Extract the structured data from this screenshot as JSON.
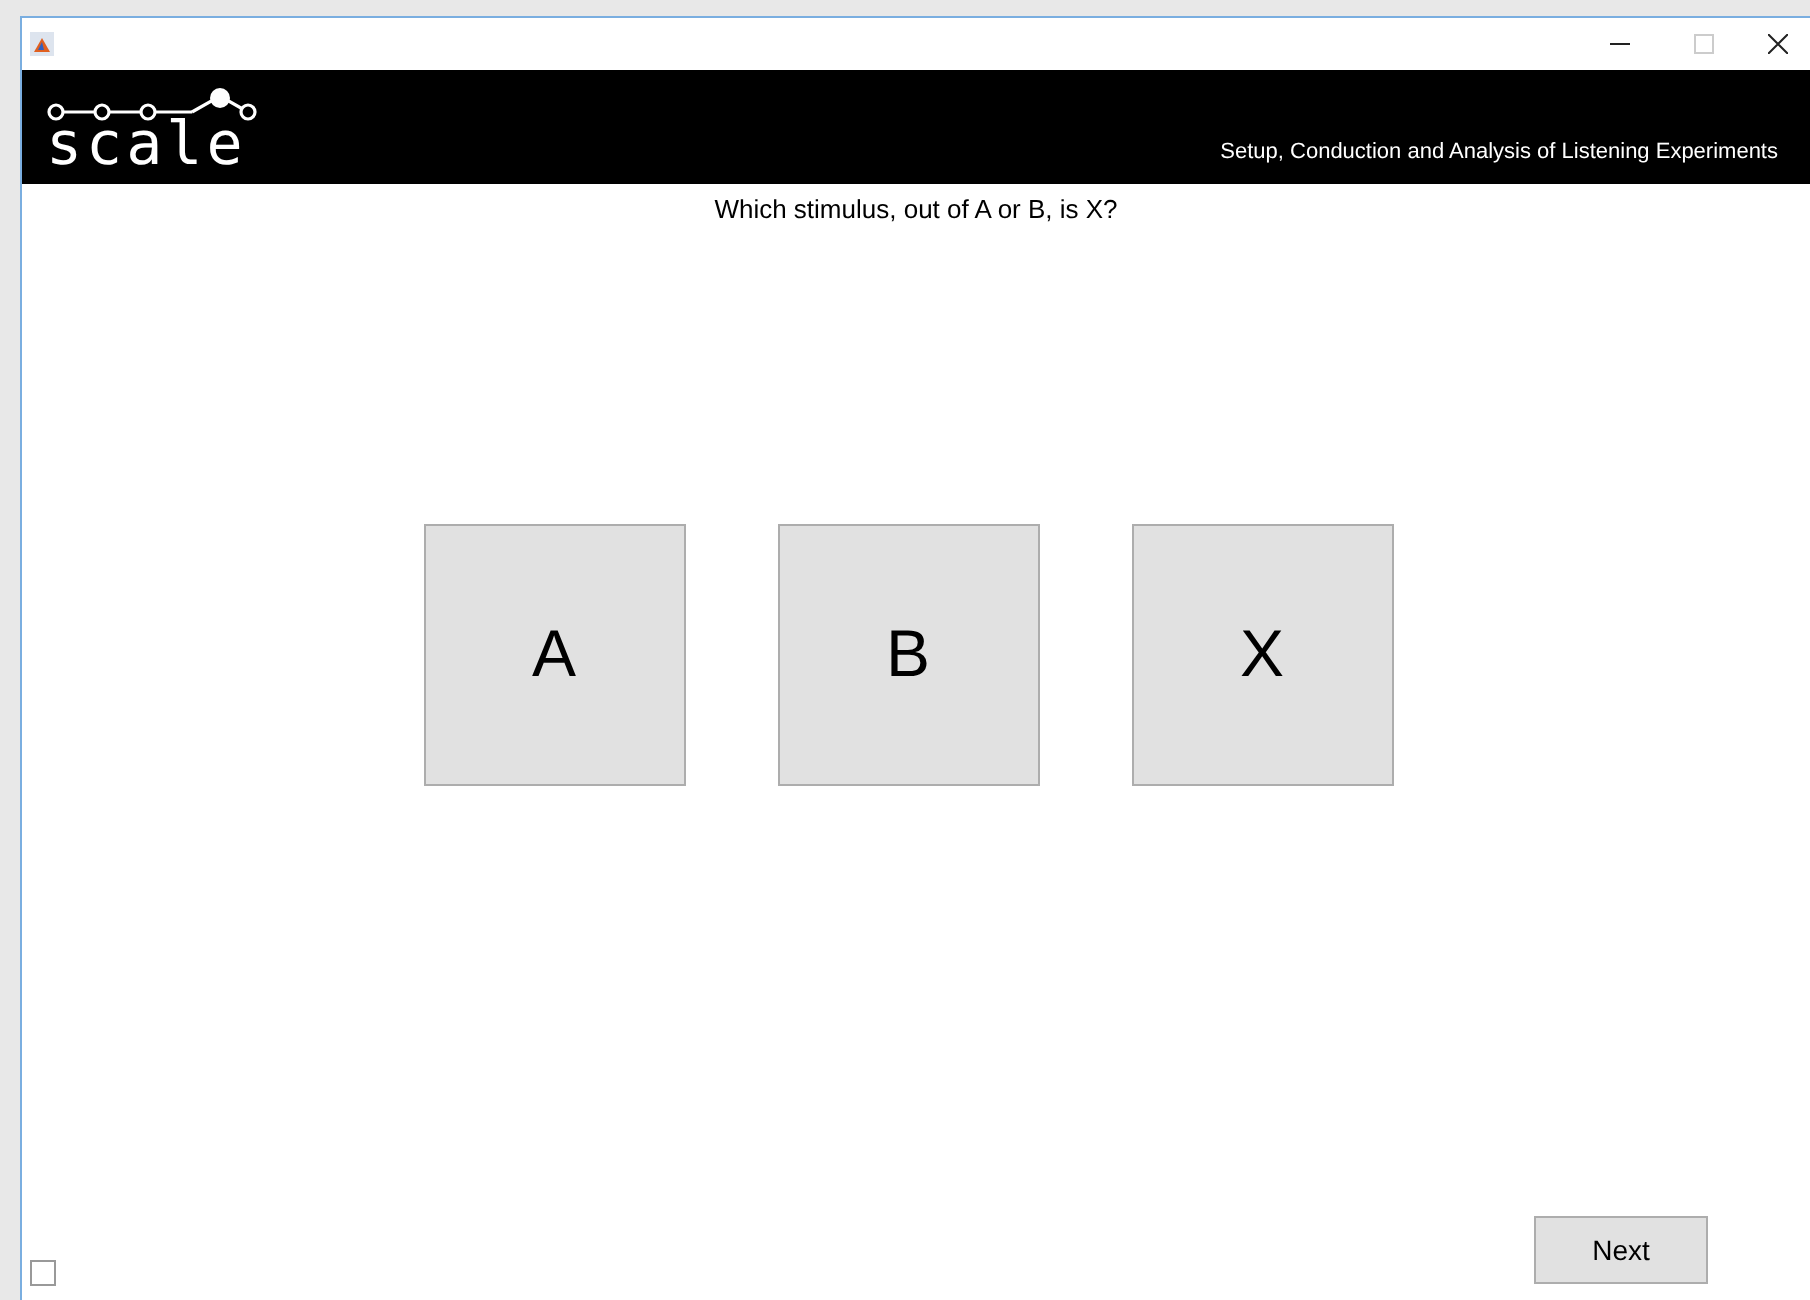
{
  "header": {
    "logo": "scale",
    "tagline": "Setup, Conduction and Analysis of Listening Experiments"
  },
  "question": "Which stimulus, out of A or B, is X?",
  "stimuli": [
    {
      "label": "A"
    },
    {
      "label": "B"
    },
    {
      "label": "X"
    }
  ],
  "checkbox": {
    "checked": false
  },
  "next_button": "Next"
}
